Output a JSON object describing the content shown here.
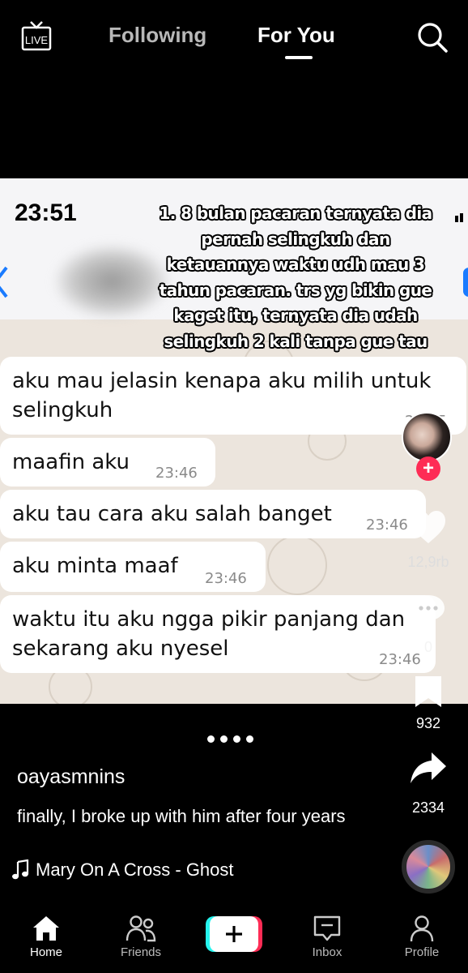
{
  "top_bar": {
    "live_label": "LIVE",
    "tabs": [
      {
        "label": "Following",
        "active": false
      },
      {
        "label": "For You",
        "active": true
      }
    ]
  },
  "video": {
    "status_time": "23:51",
    "caption_lines": [
      "1. 8 bulan pacaran ternyata dia",
      "pernah selingkuh dan",
      "ketauannya waktu udh mau 3",
      "tahun pacaran. trs yg bikin gue",
      "kaget itu, ternyata dia udah",
      "selingkuh 2 kali tanpa gue tau"
    ],
    "messages": [
      {
        "lines": [
          "aku mau jelasin kenapa aku milih untuk",
          "selingkuh"
        ],
        "time": "23:45"
      },
      {
        "lines": [
          "maafin aku"
        ],
        "time": "23:46"
      },
      {
        "lines": [
          "aku tau cara aku salah banget"
        ],
        "time": "23:46"
      },
      {
        "lines": [
          "aku minta maaf"
        ],
        "time": "23:46"
      },
      {
        "lines": [
          "waktu itu aku ngga pikir panjang dan",
          "sekarang aku nyesel"
        ],
        "time": "23:46"
      }
    ]
  },
  "actions": {
    "likes": "12,9rb",
    "comments": "0",
    "bookmarks": "932",
    "shares": "2334"
  },
  "post": {
    "username": "oayasmnins",
    "description": "finally, I broke up with him after four years",
    "music": "Mary On A Cross - Ghost"
  },
  "nav": {
    "home": "Home",
    "friends": "Friends",
    "inbox": "Inbox",
    "profile": "Profile"
  },
  "colors": {
    "accent_pink": "#fe2c55",
    "accent_cyan": "#25f4ee",
    "chat_bg": "#ece5dd"
  }
}
